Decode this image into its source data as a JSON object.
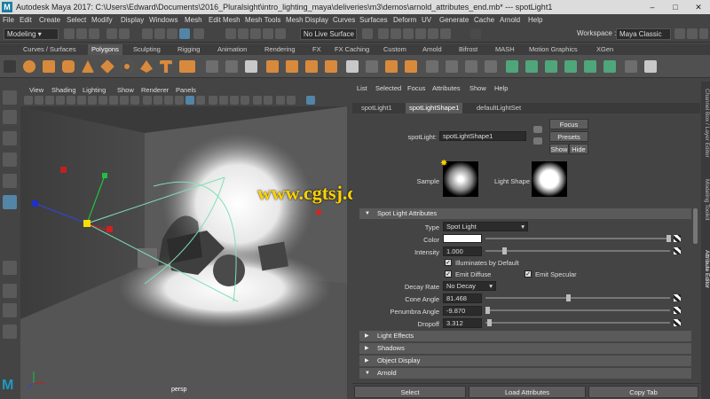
{
  "titlebar": {
    "app_icon": "maya-logo-icon",
    "title": "Autodesk Maya 2017: C:\\Users\\Edward\\Documents\\2016_Pluralsight\\intro_lighting_maya\\deliveries\\m3\\demos\\arnold_attributes_end.mb*  ---  spotLight1",
    "minimize": "–",
    "maximize": "□",
    "close": "✕"
  },
  "menubar": [
    "File",
    "Edit",
    "Create",
    "Select",
    "Modify",
    "Display",
    "Windows",
    "Mesh",
    "Edit Mesh",
    "Mesh Tools",
    "Mesh Display",
    "Curves",
    "Surfaces",
    "Deform",
    "UV",
    "Generate",
    "Cache",
    "Arnold",
    "Help"
  ],
  "statusline": {
    "mode": "Modeling",
    "live_surface": "No Live Surface",
    "workspace_label": "Workspace :",
    "workspace": "Maya Classic"
  },
  "shelf_tabs": [
    "Curves / Surfaces",
    "Polygons",
    "Sculpting",
    "Rigging",
    "Animation",
    "Rendering",
    "FX",
    "FX Caching",
    "Custom",
    "Arnold",
    "Bifrost",
    "MASH",
    "Motion Graphics",
    "XGen"
  ],
  "shelf_active": "Polygons",
  "viewport": {
    "menu": [
      "View",
      "Shading",
      "Lighting",
      "Show",
      "Renderer",
      "Panels"
    ],
    "camera_label": "persp"
  },
  "watermark": "www.cgtsj.com",
  "attribute_editor": {
    "menu": [
      "List",
      "Selected",
      "Focus",
      "Attributes",
      "Show",
      "Help"
    ],
    "tabs": [
      "spotLight1",
      "spotLightShape1",
      "defaultLightSet"
    ],
    "active_tab": "spotLightShape1",
    "node_label": "spotLight:",
    "node_name": "spotLightShape1",
    "focus_btn": "Focus",
    "presets_btn": "Presets",
    "show_btn": "Show",
    "hide_btn": "Hide",
    "sample_label": "Sample",
    "light_shape_label": "Light Shape",
    "section_spot": "Spot Light Attributes",
    "type_label": "Type",
    "type_value": "Spot Light",
    "color_label": "Color",
    "color_value": "#ffffff",
    "intensity_label": "Intensity",
    "intensity_value": "1.000",
    "illum_default": "Illuminates by Default",
    "emit_diffuse": "Emit Diffuse",
    "emit_specular": "Emit Specular",
    "decay_label": "Decay Rate",
    "decay_value": "No Decay",
    "cone_label": "Cone Angle",
    "cone_value": "81.468",
    "penumbra_label": "Penumbra Angle",
    "penumbra_value": "-9.870",
    "dropoff_label": "Dropoff",
    "dropoff_value": "3.312",
    "sections": [
      "Light Effects",
      "Shadows",
      "Object Display",
      "Arnold"
    ],
    "bottom": [
      "Select",
      "Load Attributes",
      "Copy Tab"
    ]
  },
  "side_tabs": [
    "Channel Box / Layer Editor",
    "Modeling Toolkit",
    "Attribute Editor"
  ]
}
